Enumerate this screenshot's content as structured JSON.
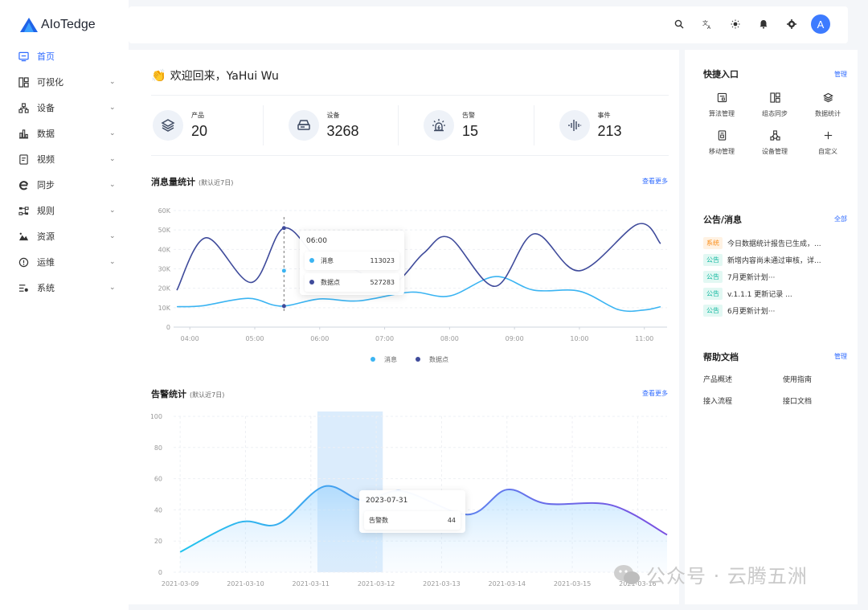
{
  "app": {
    "name": "AIoTedge"
  },
  "sidebar": {
    "items": [
      {
        "label": "首页",
        "icon": "monitor-icon",
        "active": true
      },
      {
        "label": "可视化",
        "icon": "layout-icon"
      },
      {
        "label": "设备",
        "icon": "devices-icon"
      },
      {
        "label": "数据",
        "icon": "bar-chart-icon"
      },
      {
        "label": "视频",
        "icon": "video-icon"
      },
      {
        "label": "同步",
        "icon": "sync-icon"
      },
      {
        "label": "规则",
        "icon": "rule-icon"
      },
      {
        "label": "资源",
        "icon": "mountain-icon"
      },
      {
        "label": "运维",
        "icon": "info-circle-icon"
      },
      {
        "label": "系统",
        "icon": "settings-list-icon"
      }
    ]
  },
  "topbar": {
    "icons": [
      "search-icon",
      "translate-icon",
      "sun-icon",
      "bell-icon",
      "gear-icon"
    ],
    "avatar": "A"
  },
  "welcome": {
    "text": "欢迎回来，YaHui Wu",
    "emoji": "👏"
  },
  "stats": [
    {
      "label": "产品",
      "value": "20",
      "icon": "layers-icon"
    },
    {
      "label": "设备",
      "value": "3268",
      "icon": "device-box-icon"
    },
    {
      "label": "告警",
      "value": "15",
      "icon": "alarm-icon"
    },
    {
      "label": "事件",
      "value": "213",
      "icon": "sound-wave-icon"
    }
  ],
  "message_chart": {
    "title": "消息量统计",
    "subtitle": "(默认近7日)",
    "more": "查看更多",
    "tooltip": {
      "time": "06:00",
      "rows": [
        {
          "name": "消息",
          "value": "113023"
        },
        {
          "name": "数据点",
          "value": "527283"
        }
      ]
    }
  },
  "alarm_chart": {
    "title": "告警统计",
    "subtitle": "(默认近7日)",
    "more": "查看更多",
    "tooltip": {
      "date": "2023-07-31",
      "name": "告警数",
      "value": "44"
    }
  },
  "chart_data": [
    {
      "type": "line",
      "x": [
        "04:00",
        "05:00",
        "06:00",
        "07:00",
        "08:00",
        "09:00",
        "10:00",
        "11:00"
      ],
      "ylim": [
        0,
        60000
      ],
      "yticks": [
        "0",
        "10K",
        "20K",
        "30K",
        "40K",
        "50K",
        "60K"
      ],
      "grid": true,
      "legend": "bottom",
      "series": [
        {
          "name": "消息",
          "color": "#3bb4f2",
          "points": [
            [
              3.8,
              10500
            ],
            [
              4.2,
              11000
            ],
            [
              4.9,
              14800
            ],
            [
              5.4,
              10800
            ],
            [
              6.0,
              14500
            ],
            [
              6.6,
              13500
            ],
            [
              7.4,
              18000
            ],
            [
              8.0,
              16000
            ],
            [
              8.7,
              26000
            ],
            [
              9.3,
              19000
            ],
            [
              10.0,
              18500
            ],
            [
              10.6,
              9000
            ],
            [
              11.0,
              8800
            ],
            [
              11.25,
              10500
            ]
          ]
        },
        {
          "name": "数据点",
          "color": "#3f4b9b",
          "points": [
            [
              3.8,
              19000
            ],
            [
              4.25,
              46000
            ],
            [
              4.95,
              23000
            ],
            [
              5.45,
              51000
            ],
            [
              6.0,
              34000
            ],
            [
              6.5,
              30000
            ],
            [
              7.1,
              22000
            ],
            [
              7.6,
              38000
            ],
            [
              8.0,
              46000
            ],
            [
              8.7,
              21000
            ],
            [
              9.3,
              48000
            ],
            [
              10.0,
              29000
            ],
            [
              10.9,
              53000
            ],
            [
              11.25,
              43000
            ]
          ]
        }
      ]
    },
    {
      "type": "area",
      "x": [
        "2021-03-09",
        "2021-03-10",
        "2021-03-11",
        "2021-03-12",
        "2021-03-13",
        "2021-03-14",
        "2021-03-15",
        "2021-03-16"
      ],
      "ylim": [
        0,
        100
      ],
      "yticks": [
        "0",
        "20",
        "40",
        "60",
        "80",
        "100"
      ],
      "grid": true,
      "series": [
        {
          "name": "告警数",
          "values": [
            13,
            32,
            31,
            55,
            46,
            52,
            37,
            53,
            44,
            43,
            24
          ],
          "positions": [
            0,
            0.9,
            1.5,
            2.2,
            2.8,
            3.4,
            4.4,
            5.0,
            5.6,
            6.6,
            7.45
          ]
        }
      ]
    }
  ],
  "right": {
    "quick_title": "快捷入口",
    "quick_manage": "管理",
    "quick_items": [
      {
        "label": "算法管理",
        "icon": "algorithm-icon"
      },
      {
        "label": "组态同步",
        "icon": "grid-icon"
      },
      {
        "label": "数据统计",
        "icon": "stack-icon"
      },
      {
        "label": "移动管理",
        "icon": "mobile-icon"
      },
      {
        "label": "设备管理",
        "icon": "device-tree-icon"
      },
      {
        "label": "自定义",
        "icon": "plus-icon"
      }
    ],
    "notice_title": "公告/消息",
    "notice_all": "全部",
    "notices": [
      {
        "tag": "系统",
        "text": "今日数据统计报告已生成，...",
        "tag_color": "#fa8c16",
        "tag_bg": "#fff2e3"
      },
      {
        "tag": "公告",
        "text": "新增内容尚未通过审核，详...",
        "tag_color": "#13b8a0",
        "tag_bg": "#e2f8f3"
      },
      {
        "tag": "公告",
        "text": "7月更新计划···",
        "tag_color": "#13b8a0",
        "tag_bg": "#e2f8f3"
      },
      {
        "tag": "公告",
        "text": "v.1.1.1 更新记录 ...",
        "tag_color": "#13b8a0",
        "tag_bg": "#e2f8f3"
      },
      {
        "tag": "公告",
        "text": "6月更新计划···",
        "tag_color": "#13b8a0",
        "tag_bg": "#e2f8f3"
      }
    ],
    "help_title": "帮助文档",
    "help_manage": "管理",
    "help_items": [
      "产品概述",
      "使用指南",
      "接入流程",
      "接口文档"
    ]
  },
  "watermark": "公众号 · 云腾五洲",
  "colors": {
    "accent": "#2f6bff"
  }
}
